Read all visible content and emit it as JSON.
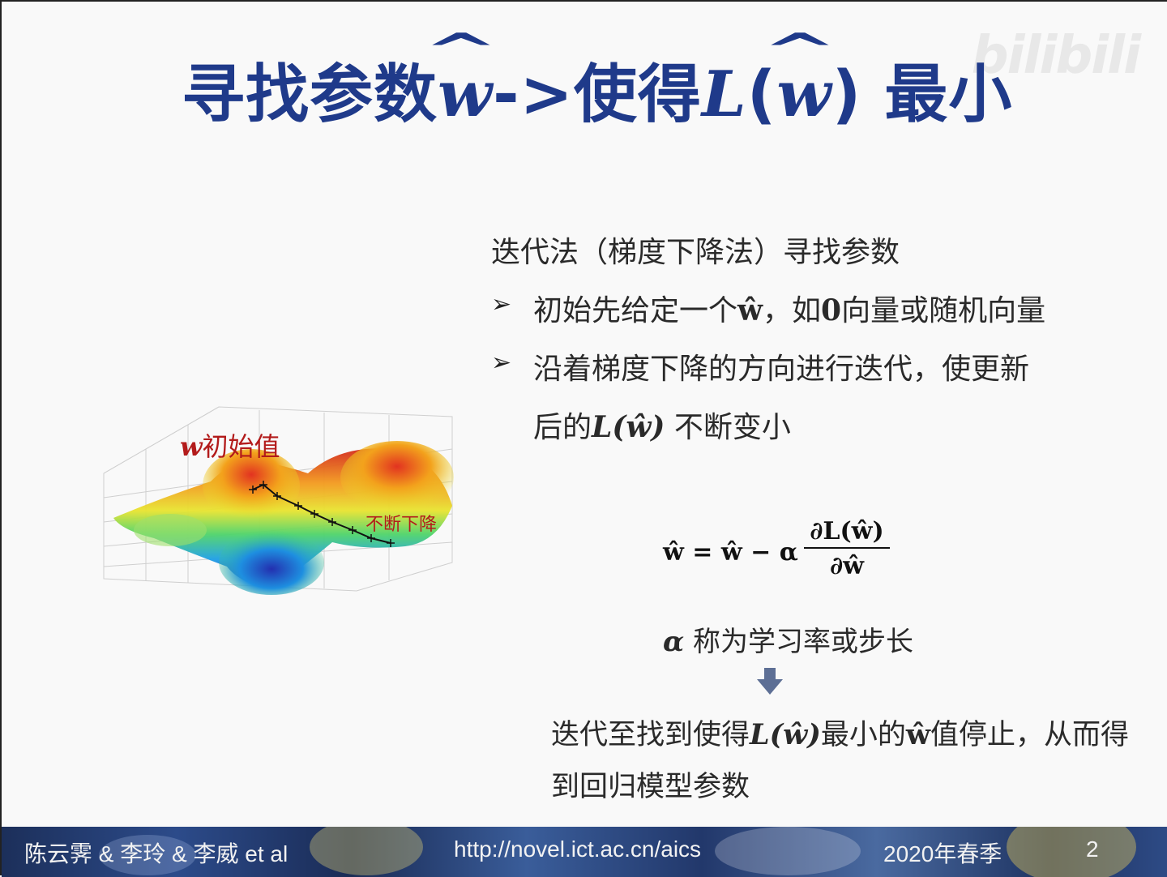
{
  "slide": {
    "title_prefix": "寻找参数",
    "title_w1": "w",
    "title_arrow": "->使得",
    "title_L": "L",
    "title_paren_open": "(",
    "title_w2": "w",
    "title_paren_close": ")",
    "title_suffix": " 最小",
    "watermark": "bilibili"
  },
  "figure": {
    "init_w": "w",
    "init_label": "初始值",
    "descend_label": "不断下降"
  },
  "content": {
    "intro": "迭代法（梯度下降法）寻找参数",
    "bullet1_a": "初始先给定一个",
    "bullet1_w": "ŵ",
    "bullet1_b": "，如",
    "bullet1_zero": "0",
    "bullet1_c": "向量或随机向量",
    "bullet2_line1": "沿着梯度下降的方向进行迭代，使更新",
    "bullet2_a": "后的",
    "bullet2_math": "L(ŵ)",
    "bullet2_b": " 不断变小",
    "eq_lhs": "ŵ = ŵ − α",
    "eq_num": "∂L(ŵ)",
    "eq_den": "∂ŵ",
    "alpha": "α",
    "alpha_desc": " 称为学习率或步长",
    "conclusion_a": "迭代至找到使得",
    "conclusion_math": "L(ŵ)",
    "conclusion_b": "最小的",
    "conclusion_w": "ŵ",
    "conclusion_c": "值停止，从而得",
    "conclusion_line2": "到回归模型参数"
  },
  "footer": {
    "authors": "陈云霁 & 李玲 & 李威 et al",
    "url": "http://novel.ict.ac.cn/aics",
    "term": "2020年春季",
    "page": "2"
  }
}
